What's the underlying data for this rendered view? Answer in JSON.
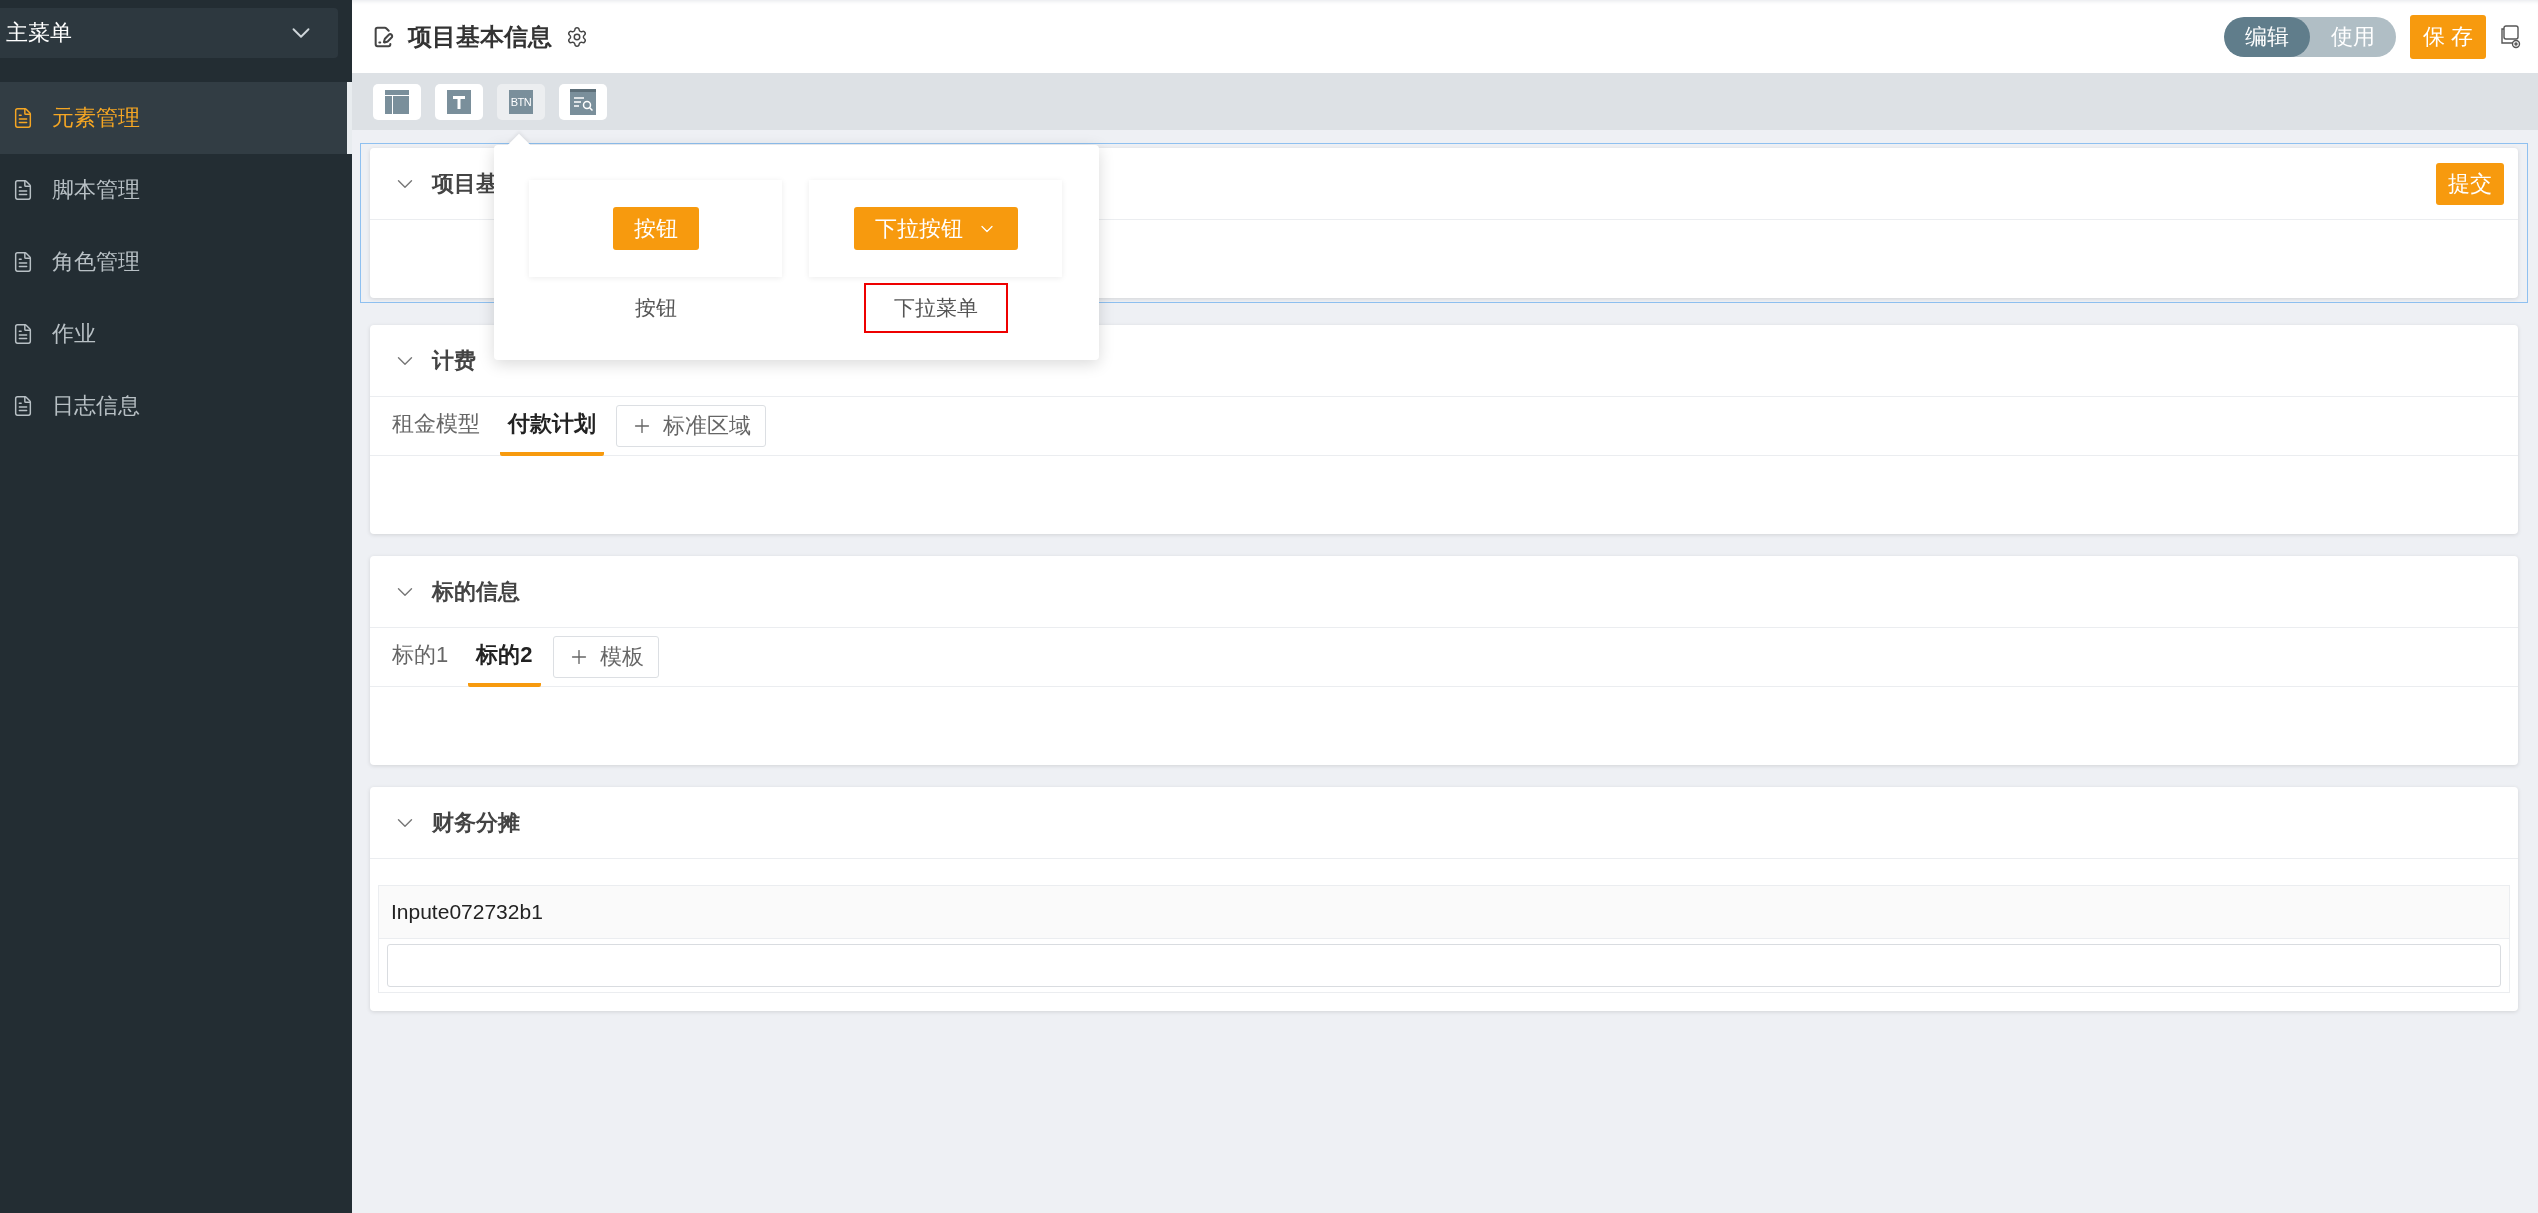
{
  "sidebar": {
    "menu_select": "主菜单",
    "items": [
      {
        "label": "元素管理",
        "selected": true
      },
      {
        "label": "脚本管理",
        "selected": false
      },
      {
        "label": "角色管理",
        "selected": false
      },
      {
        "label": "作业",
        "selected": false
      },
      {
        "label": "日志信息",
        "selected": false
      }
    ]
  },
  "header": {
    "title": "项目基本信息",
    "mode_toggle": [
      {
        "label": "编辑",
        "selected": true
      },
      {
        "label": "使用",
        "selected": false
      }
    ],
    "save_button": "保 存"
  },
  "toolbar": {
    "tools": [
      {
        "kind": "layout",
        "selected": false
      },
      {
        "kind": "text",
        "selected": false
      },
      {
        "kind": "button",
        "label": "BTN",
        "selected": true
      },
      {
        "kind": "search",
        "selected": false
      }
    ]
  },
  "popup": {
    "items": [
      {
        "kind": "button",
        "preview": "按钮",
        "label": "按钮",
        "selected": false
      },
      {
        "kind": "dropdown",
        "preview": "下拉按钮",
        "label": "下拉菜单",
        "selected": true
      }
    ]
  },
  "sections": [
    {
      "kind": "plain",
      "title": "项目基",
      "selected": true,
      "action": "提交"
    },
    {
      "kind": "tabs",
      "title": "计费",
      "selected": false,
      "tabs": [
        {
          "label": "租金模型",
          "selected": false
        },
        {
          "label": "付款计划",
          "selected": true
        }
      ],
      "add_button": "标准区域"
    },
    {
      "kind": "tabs",
      "title": "标的信息",
      "selected": false,
      "tabs": [
        {
          "label": "标的1",
          "selected": false
        },
        {
          "label": "标的2",
          "selected": true
        }
      ],
      "add_button": "模板"
    },
    {
      "kind": "form",
      "title": "财务分摊",
      "selected": false,
      "field_label": "Inpute072732b1"
    }
  ]
}
